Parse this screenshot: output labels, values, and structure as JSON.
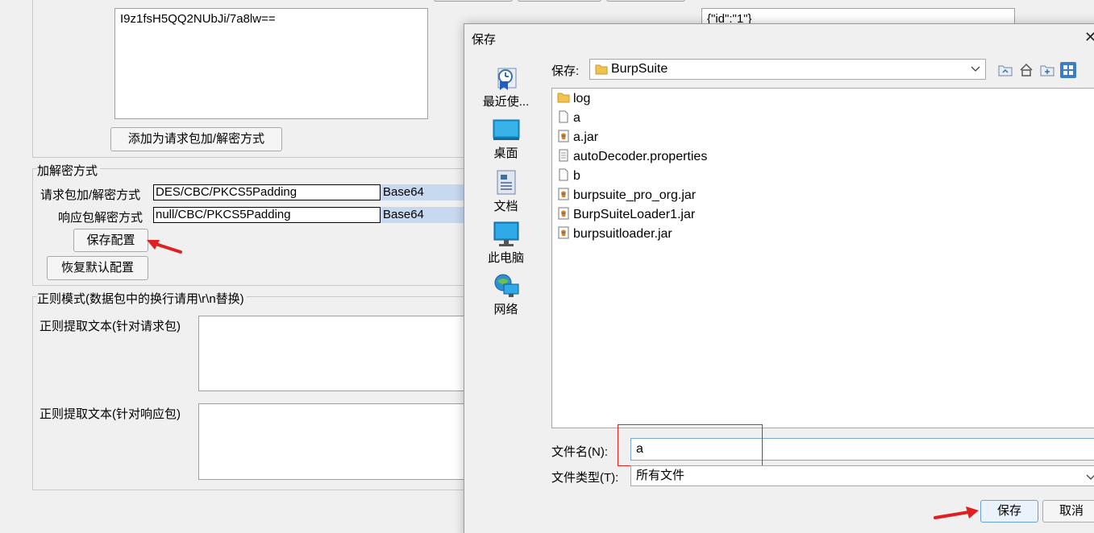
{
  "background": {
    "ciphertext": "I9z1fsH5QQ2NUbJi/7a8lw==",
    "json_preview": "{\"id\":\"1\"}",
    "add_button": "添加为请求包加/解密方式",
    "encryption_section": {
      "title": "加解密方式",
      "request_label": "请求包加/解密方式",
      "request_value": "DES/CBC/PKCS5Padding",
      "request_encoding": "Base64",
      "response_label": "响应包解密方式",
      "response_value": "null/CBC/PKCS5Padding",
      "response_encoding": "Base64",
      "save_config_button": "保存配置",
      "restore_default_button": "恢复默认配置"
    },
    "regex_section": {
      "title": "正则模式(数据包中的换行请用\\r\\n替换)",
      "request_label": "正则提取文本(针对请求包)",
      "response_label": "正则提取文本(针对响应包)"
    }
  },
  "dialog": {
    "title": "保存",
    "look_in_label": "保存:",
    "current_folder": "BurpSuite",
    "places": [
      {
        "label": "最近使...",
        "icon": "recent-icon"
      },
      {
        "label": "桌面",
        "icon": "desktop-icon"
      },
      {
        "label": "文档",
        "icon": "documents-icon"
      },
      {
        "label": "此电脑",
        "icon": "computer-icon"
      },
      {
        "label": "网络",
        "icon": "network-icon"
      }
    ],
    "files": [
      {
        "name": "log",
        "type": "folder"
      },
      {
        "name": "a",
        "type": "file"
      },
      {
        "name": "a.jar",
        "type": "jar"
      },
      {
        "name": "autoDecoder.properties",
        "type": "text"
      },
      {
        "name": "b",
        "type": "file"
      },
      {
        "name": "burpsuite_pro_org.jar",
        "type": "jar"
      },
      {
        "name": "BurpSuiteLoader1.jar",
        "type": "jar"
      },
      {
        "name": "burpsuitloader.jar",
        "type": "jar"
      }
    ],
    "filename_label": "文件名(N):",
    "filename_value": "a",
    "filetype_label": "文件类型(T):",
    "filetype_value": "所有文件",
    "save_button": "保存",
    "cancel_button": "取消"
  },
  "colors": {
    "annotation_red": "#e02020",
    "selection_blue": "#c8d8ef",
    "folder_yellow": "#f2c14e"
  }
}
